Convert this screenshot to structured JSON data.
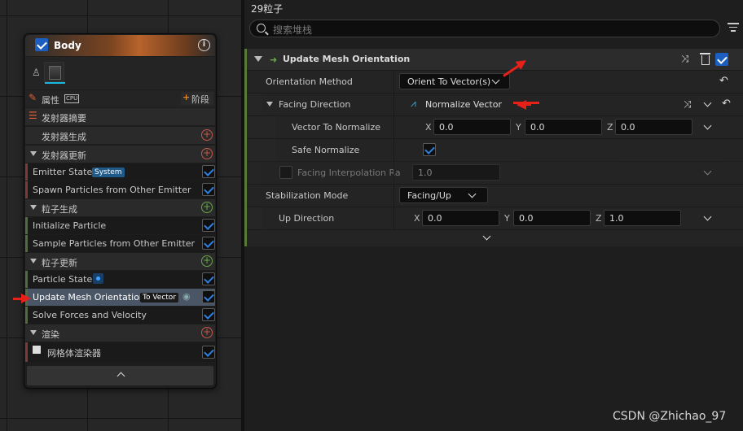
{
  "node": {
    "title": "Body",
    "info_label": "i",
    "props_label": "属性",
    "cpu_label": "CPU",
    "stage_label": "阶段",
    "emitter_summary": "发射器摘要",
    "sections": [
      {
        "label": "发射器生成",
        "kind": "plain"
      },
      {
        "label": "发射器更新",
        "kind": "section"
      },
      {
        "label": "粒子生成",
        "kind": "section"
      },
      {
        "label": "粒子更新",
        "kind": "section"
      },
      {
        "label": "渲染",
        "kind": "section"
      }
    ],
    "items": {
      "emitter_state": "Emitter State",
      "emitter_state_badge": "System",
      "spawn_other": "Spawn Particles from Other Emitter",
      "init_particle": "Initialize Particle",
      "sample_other": "Sample Particles from Other Emitter",
      "particle_state": "Particle State",
      "update_mesh": "Update Mesh Orientation",
      "update_mesh_badge": "To Vector",
      "solve_forces": "Solve Forces and Velocity",
      "mesh_renderer": "网格体渲染器"
    }
  },
  "panel": {
    "title": "29粒子",
    "search_placeholder": "搜索堆栈",
    "module_title": "Update Mesh Orientation",
    "rows": {
      "orientation_method_label": "Orientation Method",
      "orientation_method_value": "Orient To Vector(s)",
      "facing_direction_label": "Facing Direction",
      "facing_direction_value": "Normalize Vector",
      "vector_to_normalize_label": "Vector To Normalize",
      "vtn_x": "0.0",
      "vtn_y": "0.0",
      "vtn_z": "0.0",
      "safe_normalize_label": "Safe Normalize",
      "facing_interp_label": "Facing Interpolation Ra",
      "facing_interp_value": "1.0",
      "stabilization_label": "Stabilization Mode",
      "stabilization_value": "Facing/Up",
      "up_direction_label": "Up Direction",
      "up_x": "0.0",
      "up_y": "0.0",
      "up_z": "1.0"
    },
    "axis": {
      "x": "X",
      "y": "Y",
      "z": "Z"
    }
  },
  "watermark": "CSDN @Zhichao_97",
  "colors": {
    "accent_blue": "#2d7fe0",
    "annotation_red": "#e8201a",
    "module_green": "#5a7a3a"
  }
}
